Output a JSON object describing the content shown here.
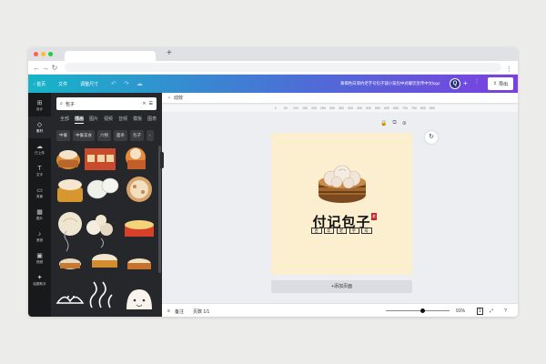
{
  "browser": {
    "new_tab": "+"
  },
  "toolbar": {
    "home": "首页",
    "file": "文件",
    "resize": "调整尺寸",
    "doc_title": "黄褐色白简约老字号包子铺小笼包中式餐饮宣传中文logo",
    "avatar": "Q",
    "plus": "+",
    "export": "导出"
  },
  "rail": [
    {
      "icon": "⊞",
      "label": "设计"
    },
    {
      "icon": "◇",
      "label": "素材"
    },
    {
      "icon": "☁",
      "label": "已上传"
    },
    {
      "icon": "T",
      "label": "文字"
    },
    {
      "icon": "▭",
      "label": "背景"
    },
    {
      "icon": "▦",
      "label": "图片"
    },
    {
      "icon": "♪",
      "label": "音频"
    },
    {
      "icon": "▣",
      "label": "视频"
    },
    {
      "icon": "✦",
      "label": "绘图助手"
    }
  ],
  "search": {
    "value": "包子"
  },
  "categories": [
    "全部",
    "插画",
    "图片",
    "视频",
    "音频",
    "模板",
    "图表"
  ],
  "active_category": "插画",
  "chips": [
    "中餐",
    "中餐美食",
    "六物",
    "面条",
    "包子",
    "›"
  ],
  "canvas_toolbar": {
    "animate": "动效"
  },
  "ruler": [
    "0",
    "50",
    "100",
    "150",
    "200",
    "250",
    "300",
    "350",
    "400",
    "450",
    "500",
    "550",
    "600",
    "650",
    "700",
    "750",
    "800",
    "850"
  ],
  "logo": {
    "title": "付记包子",
    "seal": "老",
    "subtitle": [
      "百",
      "年",
      "老",
      "字",
      "号"
    ]
  },
  "add_page": "+添加页面",
  "footer": {
    "notes": "备注",
    "page": "页数 1/1",
    "zoom": "91%",
    "page_count": "1"
  },
  "colors": {
    "accent_start": "#16b5c8",
    "accent_end": "#7b3fe0",
    "canvas_bg": "#fcefd0",
    "seal": "#c0272d"
  }
}
